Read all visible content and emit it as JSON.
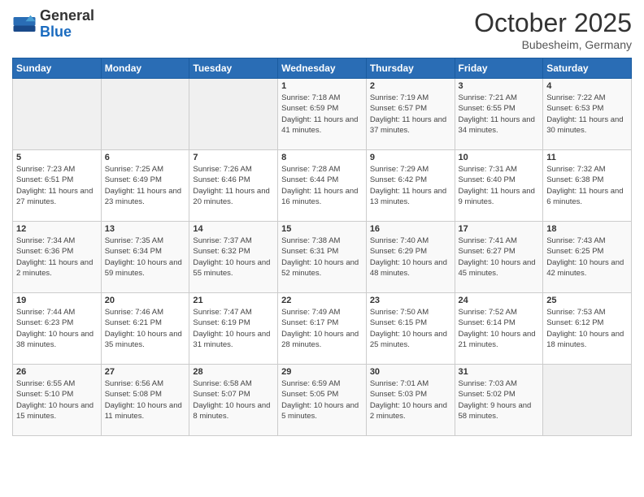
{
  "header": {
    "logo_general": "General",
    "logo_blue": "Blue",
    "month_title": "October 2025",
    "location": "Bubesheim, Germany"
  },
  "calendar": {
    "headers": [
      "Sunday",
      "Monday",
      "Tuesday",
      "Wednesday",
      "Thursday",
      "Friday",
      "Saturday"
    ],
    "rows": [
      [
        {
          "day": "",
          "info": ""
        },
        {
          "day": "",
          "info": ""
        },
        {
          "day": "",
          "info": ""
        },
        {
          "day": "1",
          "info": "Sunrise: 7:18 AM\nSunset: 6:59 PM\nDaylight: 11 hours\nand 41 minutes."
        },
        {
          "day": "2",
          "info": "Sunrise: 7:19 AM\nSunset: 6:57 PM\nDaylight: 11 hours\nand 37 minutes."
        },
        {
          "day": "3",
          "info": "Sunrise: 7:21 AM\nSunset: 6:55 PM\nDaylight: 11 hours\nand 34 minutes."
        },
        {
          "day": "4",
          "info": "Sunrise: 7:22 AM\nSunset: 6:53 PM\nDaylight: 11 hours\nand 30 minutes."
        }
      ],
      [
        {
          "day": "5",
          "info": "Sunrise: 7:23 AM\nSunset: 6:51 PM\nDaylight: 11 hours\nand 27 minutes."
        },
        {
          "day": "6",
          "info": "Sunrise: 7:25 AM\nSunset: 6:49 PM\nDaylight: 11 hours\nand 23 minutes."
        },
        {
          "day": "7",
          "info": "Sunrise: 7:26 AM\nSunset: 6:46 PM\nDaylight: 11 hours\nand 20 minutes."
        },
        {
          "day": "8",
          "info": "Sunrise: 7:28 AM\nSunset: 6:44 PM\nDaylight: 11 hours\nand 16 minutes."
        },
        {
          "day": "9",
          "info": "Sunrise: 7:29 AM\nSunset: 6:42 PM\nDaylight: 11 hours\nand 13 minutes."
        },
        {
          "day": "10",
          "info": "Sunrise: 7:31 AM\nSunset: 6:40 PM\nDaylight: 11 hours\nand 9 minutes."
        },
        {
          "day": "11",
          "info": "Sunrise: 7:32 AM\nSunset: 6:38 PM\nDaylight: 11 hours\nand 6 minutes."
        }
      ],
      [
        {
          "day": "12",
          "info": "Sunrise: 7:34 AM\nSunset: 6:36 PM\nDaylight: 11 hours\nand 2 minutes."
        },
        {
          "day": "13",
          "info": "Sunrise: 7:35 AM\nSunset: 6:34 PM\nDaylight: 10 hours\nand 59 minutes."
        },
        {
          "day": "14",
          "info": "Sunrise: 7:37 AM\nSunset: 6:32 PM\nDaylight: 10 hours\nand 55 minutes."
        },
        {
          "day": "15",
          "info": "Sunrise: 7:38 AM\nSunset: 6:31 PM\nDaylight: 10 hours\nand 52 minutes."
        },
        {
          "day": "16",
          "info": "Sunrise: 7:40 AM\nSunset: 6:29 PM\nDaylight: 10 hours\nand 48 minutes."
        },
        {
          "day": "17",
          "info": "Sunrise: 7:41 AM\nSunset: 6:27 PM\nDaylight: 10 hours\nand 45 minutes."
        },
        {
          "day": "18",
          "info": "Sunrise: 7:43 AM\nSunset: 6:25 PM\nDaylight: 10 hours\nand 42 minutes."
        }
      ],
      [
        {
          "day": "19",
          "info": "Sunrise: 7:44 AM\nSunset: 6:23 PM\nDaylight: 10 hours\nand 38 minutes."
        },
        {
          "day": "20",
          "info": "Sunrise: 7:46 AM\nSunset: 6:21 PM\nDaylight: 10 hours\nand 35 minutes."
        },
        {
          "day": "21",
          "info": "Sunrise: 7:47 AM\nSunset: 6:19 PM\nDaylight: 10 hours\nand 31 minutes."
        },
        {
          "day": "22",
          "info": "Sunrise: 7:49 AM\nSunset: 6:17 PM\nDaylight: 10 hours\nand 28 minutes."
        },
        {
          "day": "23",
          "info": "Sunrise: 7:50 AM\nSunset: 6:15 PM\nDaylight: 10 hours\nand 25 minutes."
        },
        {
          "day": "24",
          "info": "Sunrise: 7:52 AM\nSunset: 6:14 PM\nDaylight: 10 hours\nand 21 minutes."
        },
        {
          "day": "25",
          "info": "Sunrise: 7:53 AM\nSunset: 6:12 PM\nDaylight: 10 hours\nand 18 minutes."
        }
      ],
      [
        {
          "day": "26",
          "info": "Sunrise: 6:55 AM\nSunset: 5:10 PM\nDaylight: 10 hours\nand 15 minutes."
        },
        {
          "day": "27",
          "info": "Sunrise: 6:56 AM\nSunset: 5:08 PM\nDaylight: 10 hours\nand 11 minutes."
        },
        {
          "day": "28",
          "info": "Sunrise: 6:58 AM\nSunset: 5:07 PM\nDaylight: 10 hours\nand 8 minutes."
        },
        {
          "day": "29",
          "info": "Sunrise: 6:59 AM\nSunset: 5:05 PM\nDaylight: 10 hours\nand 5 minutes."
        },
        {
          "day": "30",
          "info": "Sunrise: 7:01 AM\nSunset: 5:03 PM\nDaylight: 10 hours\nand 2 minutes."
        },
        {
          "day": "31",
          "info": "Sunrise: 7:03 AM\nSunset: 5:02 PM\nDaylight: 9 hours\nand 58 minutes."
        },
        {
          "day": "",
          "info": ""
        }
      ]
    ]
  }
}
